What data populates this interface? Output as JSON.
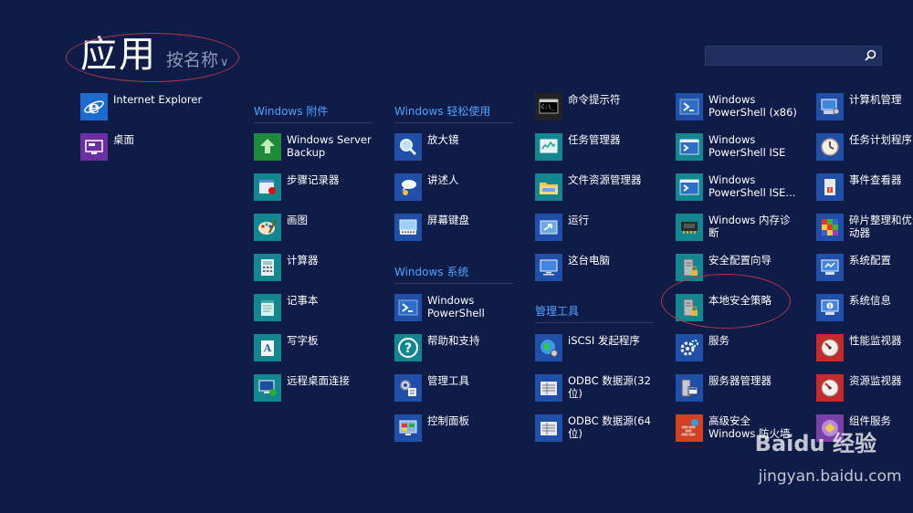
{
  "header": {
    "title": "应用",
    "sort_label": "按名称"
  },
  "search": {
    "value": "",
    "placeholder": ""
  },
  "groups": {
    "accessories": "Windows 附件",
    "ease": "Windows 轻松使用",
    "system": "Windows 系统",
    "admin_tools": "管理工具"
  },
  "apps": {
    "ie": "Internet Explorer",
    "desktop": "桌面",
    "server_backup": "Windows Server\nBackup",
    "steps_recorder": "步骤记录器",
    "paint": "画图",
    "calculator": "计算器",
    "notepad": "记事本",
    "wordpad": "写字板",
    "rdp": "远程桌面连接",
    "magnifier": "放大镜",
    "narrator": "讲述人",
    "osk": "屏幕键盘",
    "powershell": "Windows\nPowerShell",
    "help": "帮助和支持",
    "admin_tools": "管理工具",
    "control_panel": "控制面板",
    "cmd": "命令提示符",
    "task_manager": "任务管理器",
    "explorer": "文件资源管理器",
    "run": "运行",
    "this_pc": "这台电脑",
    "iscsi": "iSCSI 发起程序",
    "odbc32": "ODBC 数据源(32\n位)",
    "odbc64": "ODBC 数据源(64\n位)",
    "ps_x86": "Windows\nPowerShell (x86)",
    "ps_ise": "Windows\nPowerShell ISE",
    "ps_ise2": "Windows\nPowerShell ISE...",
    "mem_diag": "Windows 内存诊\n断",
    "sec_wizard": "安全配置向导",
    "local_sec": "本地安全策略",
    "services": "服务",
    "server_mgr": "服务器管理器",
    "firewall": "高级安全\nWindows 防火墙",
    "comp_mgmt": "计算机管理",
    "task_sched": "任务计划程序",
    "event_viewer": "事件查看器",
    "defrag": "碎片整理和优化\n动器",
    "sys_config": "系统配置",
    "sys_info": "系统信息",
    "perf_mon": "性能监视器",
    "res_mon": "资源监视器",
    "comp_services": "组件服务"
  },
  "watermark": {
    "brand": "Baidu 经验",
    "url": "jingyan.baidu.com"
  }
}
